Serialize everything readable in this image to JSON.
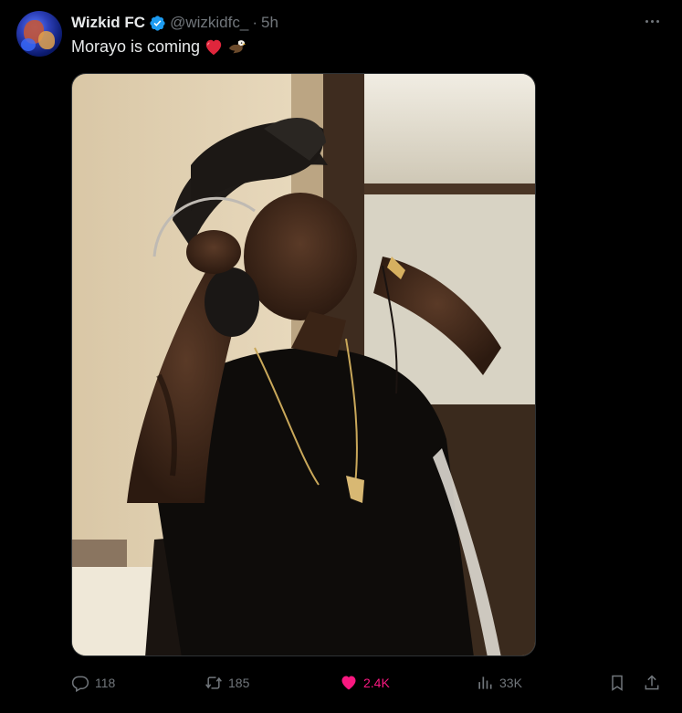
{
  "tweet": {
    "author_name": "Wizkid FC",
    "handle": "@wizkidfc_",
    "separator": "·",
    "time": "5h",
    "text": "Morayo is coming",
    "emojis": [
      "red-heart",
      "eagle"
    ]
  },
  "actions": {
    "replies": "118",
    "retweets": "185",
    "likes": "2.4K",
    "views": "33K"
  },
  "colors": {
    "background": "#000000",
    "text": "#e7e9ea",
    "muted": "#71767b",
    "verified": "#1d9bf0",
    "like": "#f91880"
  },
  "icons": [
    "verified-badge-icon",
    "more-icon",
    "reply-icon",
    "retweet-icon",
    "heart-icon",
    "views-icon",
    "bookmark-icon",
    "share-icon"
  ]
}
